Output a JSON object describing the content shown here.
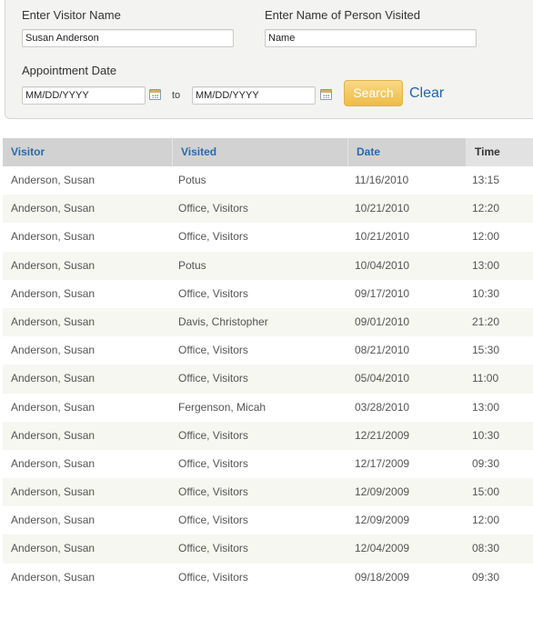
{
  "form": {
    "visitor_label": "Enter Visitor Name",
    "visitor_value": "Susan Anderson",
    "visited_label": "Enter Name of Person Visited",
    "visited_placeholder": "Name",
    "date_label": "Appointment Date",
    "date_from_placeholder": "MM/DD/YYYY",
    "date_to_placeholder": "MM/DD/YYYY",
    "to_text": "to",
    "search_label": "Search",
    "clear_label": "Clear"
  },
  "table": {
    "headers": [
      "Visitor",
      "Visited",
      "Date",
      "Time"
    ],
    "rows": [
      [
        "Anderson, Susan",
        "Potus",
        "11/16/2010",
        "13:15"
      ],
      [
        "Anderson, Susan",
        "Office, Visitors",
        "10/21/2010",
        "12:20"
      ],
      [
        "Anderson, Susan",
        "Office, Visitors",
        "10/21/2010",
        "12:00"
      ],
      [
        "Anderson, Susan",
        "Potus",
        "10/04/2010",
        "13:00"
      ],
      [
        "Anderson, Susan",
        "Office, Visitors",
        "09/17/2010",
        "10:30"
      ],
      [
        "Anderson, Susan",
        "Davis, Christopher",
        "09/01/2010",
        "21:20"
      ],
      [
        "Anderson, Susan",
        "Office, Visitors",
        "08/21/2010",
        "15:30"
      ],
      [
        "Anderson, Susan",
        "Office, Visitors",
        "05/04/2010",
        "11:00"
      ],
      [
        "Anderson, Susan",
        "Fergenson, Micah",
        "03/28/2010",
        "13:00"
      ],
      [
        "Anderson, Susan",
        "Office, Visitors",
        "12/21/2009",
        "10:30"
      ],
      [
        "Anderson, Susan",
        "Office, Visitors",
        "12/17/2009",
        "09:30"
      ],
      [
        "Anderson, Susan",
        "Office, Visitors",
        "12/09/2009",
        "15:00"
      ],
      [
        "Anderson, Susan",
        "Office, Visitors",
        "12/09/2009",
        "12:00"
      ],
      [
        "Anderson, Susan",
        "Office, Visitors",
        "12/04/2009",
        "08:30"
      ],
      [
        "Anderson, Susan",
        "Office, Visitors",
        "09/18/2009",
        "09:30"
      ]
    ]
  },
  "colors": {
    "link": "#2166a6",
    "search_button": "#eebc46",
    "header_bg": "#d2d2d2",
    "alt_row": "#f6f7f1"
  },
  "icons": {
    "date_from_picker": "calendar-icon",
    "date_to_picker": "calendar-icon"
  }
}
